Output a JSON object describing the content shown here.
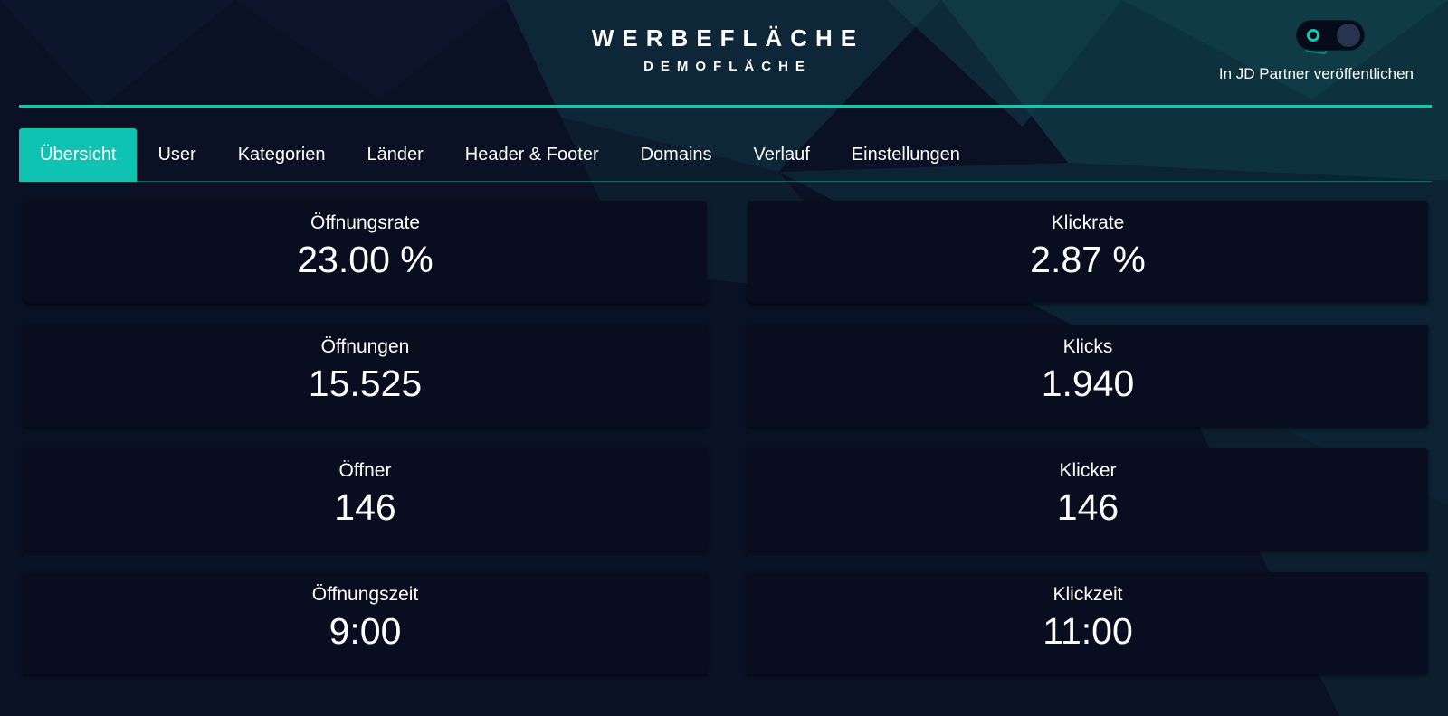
{
  "header": {
    "title": "WERBEFLÄCHE",
    "subtitle": "DEMOFLÄCHE",
    "publish_label": "In JD Partner veröffentlichen",
    "publish_toggle_on": false
  },
  "tabs": [
    {
      "label": "Übersicht",
      "active": true
    },
    {
      "label": "User",
      "active": false
    },
    {
      "label": "Kategorien",
      "active": false
    },
    {
      "label": "Länder",
      "active": false
    },
    {
      "label": "Header & Footer",
      "active": false
    },
    {
      "label": "Domains",
      "active": false
    },
    {
      "label": "Verlauf",
      "active": false
    },
    {
      "label": "Einstellungen",
      "active": false
    }
  ],
  "stats": {
    "left": [
      {
        "label": "Öffnungsrate",
        "value": "23.00 %"
      },
      {
        "label": "Öffnungen",
        "value": "15.525"
      },
      {
        "label": "Öffner",
        "value": "146"
      },
      {
        "label": "Öffnungszeit",
        "value": "9:00"
      }
    ],
    "right": [
      {
        "label": "Klickrate",
        "value": "2.87 %"
      },
      {
        "label": "Klicks",
        "value": "1.940"
      },
      {
        "label": "Klicker",
        "value": "146"
      },
      {
        "label": "Klickzeit",
        "value": "11:00"
      }
    ]
  },
  "colors": {
    "accent": "#14c6b2",
    "background": "#0a1124",
    "card": "#080d20",
    "text": "#ffffff"
  }
}
